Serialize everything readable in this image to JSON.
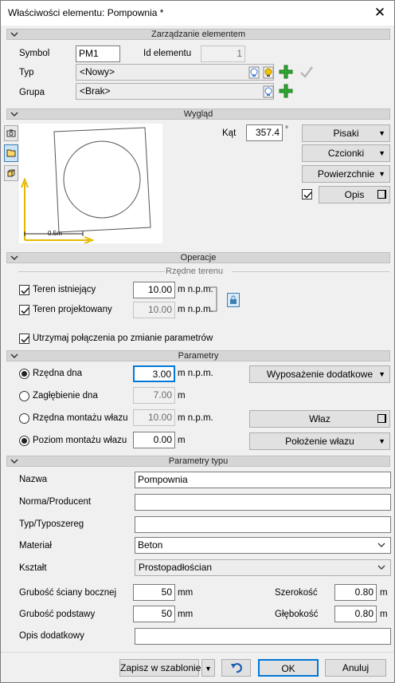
{
  "window": {
    "title": "Właściwości elementu: Pompownia *"
  },
  "sections": {
    "manage": "Zarządzanie elementem",
    "look": "Wygląd",
    "ops": "Operacje",
    "terrain": "Rzędne terenu",
    "params": "Parametry",
    "type_params": "Parametry typu"
  },
  "manage": {
    "symbol_label": "Symbol",
    "symbol_value": "PM1",
    "id_label": "Id elementu",
    "id_value": "1",
    "typ_label": "Typ",
    "typ_value": "<Nowy>",
    "grupa_label": "Grupa",
    "grupa_value": "<Brak>"
  },
  "look": {
    "kat_label": "Kąt",
    "kat_value": "357.4",
    "kat_unit": "°",
    "pisaki": "Pisaki",
    "czcionki": "Czcionki",
    "powierzchnie": "Powierzchnie",
    "opis": "Opis",
    "scale_label": "0.5m"
  },
  "ops": {
    "teren_ist_label": "Teren istniejący",
    "teren_ist_value": "10.00",
    "teren_proj_label": "Teren projektowany",
    "teren_proj_value": "10.00",
    "unit": "m n.p.m.",
    "keep_label": "Utrzymaj połączenia po zmianie parametrów"
  },
  "params": {
    "rzedna_dna_label": "Rzędna dna",
    "rzedna_dna_value": "3.00",
    "zagl_label": "Zagłębienie dna",
    "zagl_value": "7.00",
    "rzedna_mont_label": "Rzędna montażu włazu",
    "rzedna_mont_value": "10.00",
    "poziom_label": "Poziom montażu włazu",
    "poziom_value": "0.00",
    "unit_npm": "m n.p.m.",
    "unit_m": "m",
    "wyposazenie": "Wyposażenie dodatkowe",
    "wlaz": "Właz",
    "polozenie": "Położenie włazu"
  },
  "type": {
    "nazwa_label": "Nazwa",
    "nazwa_value": "Pompownia",
    "norma_label": "Norma/Producent",
    "norma_value": "",
    "typo_label": "Typ/Typoszereg",
    "typo_value": "",
    "material_label": "Materiał",
    "material_value": "Beton",
    "ksztalt_label": "Kształt",
    "ksztalt_value": "Prostopadłościan",
    "grub_sciany_label": "Grubość ściany bocznej",
    "grub_sciany_value": "50",
    "grub_podst_label": "Grubość podstawy",
    "grub_podst_value": "50",
    "unit_mm": "mm",
    "szer_label": "Szerokość",
    "szer_value": "0.80",
    "glab_label": "Głębokość",
    "glab_value": "0.80",
    "unit_m": "m",
    "opis_dod_label": "Opis dodatkowy",
    "opis_dod_value": ""
  },
  "footer": {
    "zapisz": "Zapisz w szablonie",
    "ok": "OK",
    "anuluj": "Anuluj"
  }
}
